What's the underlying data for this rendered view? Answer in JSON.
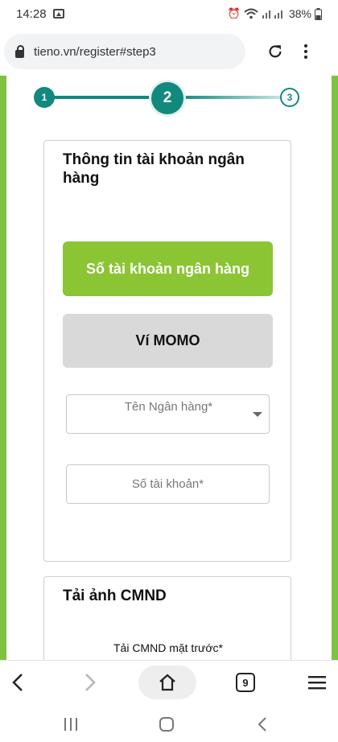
{
  "status_bar": {
    "time": "14:28",
    "battery": "38%"
  },
  "browser": {
    "url": "tieno.vn/register#step3",
    "tab_count": "9"
  },
  "stepper": {
    "steps": [
      "1",
      "2",
      "3"
    ],
    "active_step": 2
  },
  "bank_section": {
    "title": "Thông tin tài khoản ngân hàng",
    "bank_account_button": "Số tài khoản ngân hàng",
    "momo_button": "Ví MOMO",
    "bank_name_placeholder": "Tên Ngân hàng*",
    "account_number_placeholder": "Số tài khoản*"
  },
  "id_section": {
    "title": "Tải ảnh CMND",
    "front_label": "Tải CMND mặt trước*"
  },
  "colors": {
    "brand_green": "#8bc534",
    "teal": "#12897d",
    "side_green": "#7ec242"
  }
}
